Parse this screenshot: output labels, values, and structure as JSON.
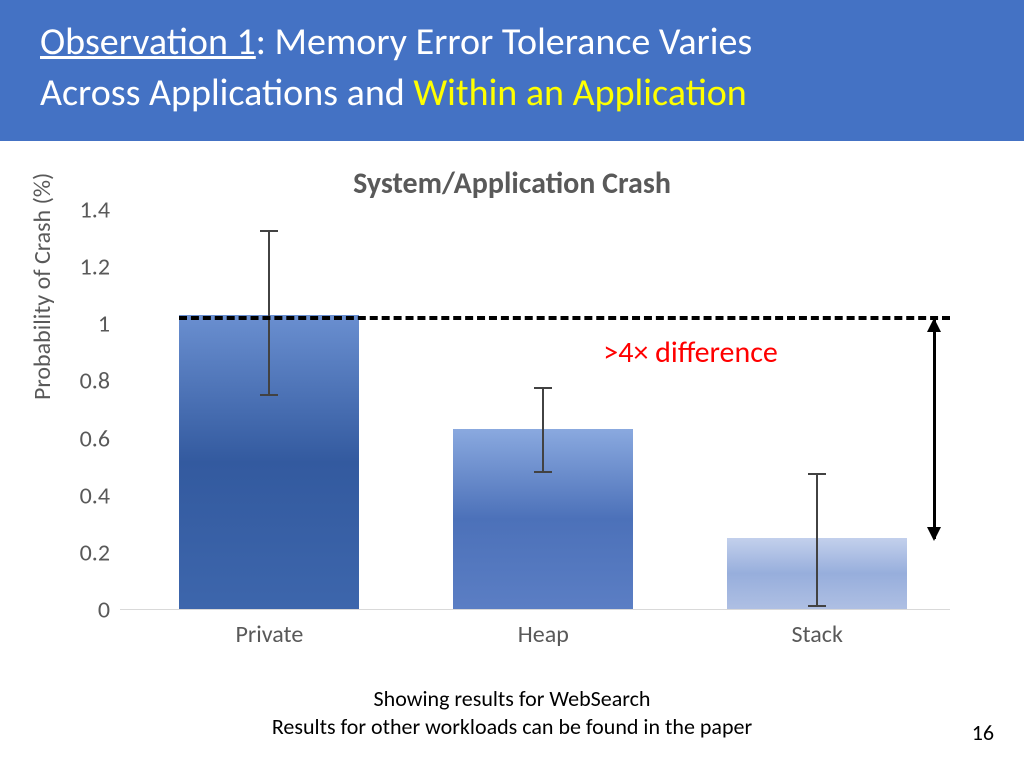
{
  "title": {
    "underlined": "Observation 1",
    "rest1": ": Memory Error Tolerance Varies",
    "across": "Across Applications and ",
    "highlight": "Within an Application"
  },
  "chart_data": {
    "type": "bar",
    "title": "System/Application Crash",
    "ylabel": "Probability of Crash (%)",
    "xlabel": "",
    "categories": [
      "Private",
      "Heap",
      "Stack"
    ],
    "values": [
      1.03,
      0.63,
      0.25
    ],
    "error_low": [
      0.75,
      0.48,
      0.01
    ],
    "error_high": [
      1.33,
      0.78,
      0.48
    ],
    "ylim": [
      0,
      1.4
    ],
    "yticks": [
      0,
      0.2,
      0.4,
      0.6,
      0.8,
      1,
      1.2,
      1.4
    ],
    "reference_line_y": 1.03,
    "annotation": ">4× difference"
  },
  "caption": {
    "line1": "Showing results for WebSearch",
    "line2": "Results for other workloads can be found in the paper"
  },
  "page_number": "16"
}
